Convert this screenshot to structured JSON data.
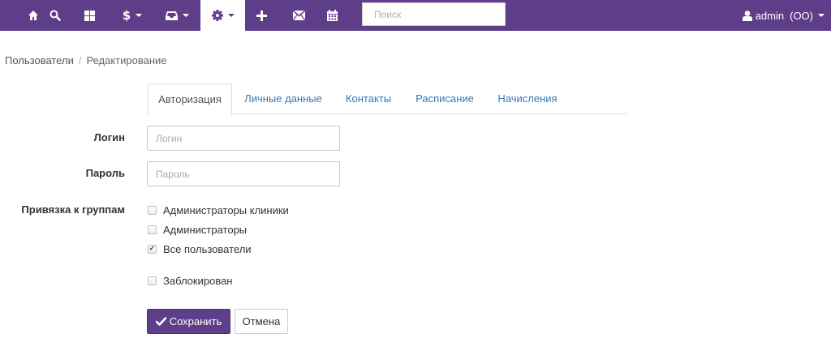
{
  "navbar": {
    "bg_color": "#5f3e89",
    "items": [
      {
        "icon": "home-icon"
      },
      {
        "icon": "search-icon"
      },
      {
        "icon": "grid-icon"
      },
      {
        "icon": "dollar-icon",
        "dropdown": true
      },
      {
        "icon": "inbox-icon",
        "dropdown": true
      },
      {
        "icon": "gear-icon",
        "dropdown": true,
        "active": true
      },
      {
        "icon": "plus-icon"
      },
      {
        "icon": "envelope-icon"
      },
      {
        "icon": "calendar-icon"
      }
    ],
    "search_placeholder": "Поиск",
    "user_icon": "user-icon",
    "user_name": "admin",
    "user_org": "(OO)"
  },
  "breadcrumb": {
    "items": [
      "Пользователи",
      "Редактирование"
    ],
    "separator": "/"
  },
  "tabs": [
    {
      "label": "Авторизация",
      "active": true
    },
    {
      "label": "Личные данные"
    },
    {
      "label": "Контакты"
    },
    {
      "label": "Расписание"
    },
    {
      "label": "Начисления"
    }
  ],
  "form": {
    "login_label": "Логин",
    "login_placeholder": "Логин",
    "login_value": "",
    "password_label": "Пароль",
    "password_placeholder": "Пароль",
    "password_value": "",
    "groups_label": "Привязка к группам",
    "groups": [
      {
        "label": "Администраторы клиники",
        "checked": false
      },
      {
        "label": "Администраторы",
        "checked": false
      },
      {
        "label": "Все пользователи",
        "checked": true
      }
    ],
    "blocked_label": "Заблокирован",
    "blocked_checked": false
  },
  "buttons": {
    "save_label": "Сохранить",
    "save_icon": "check-icon",
    "cancel_label": "Отмена"
  }
}
